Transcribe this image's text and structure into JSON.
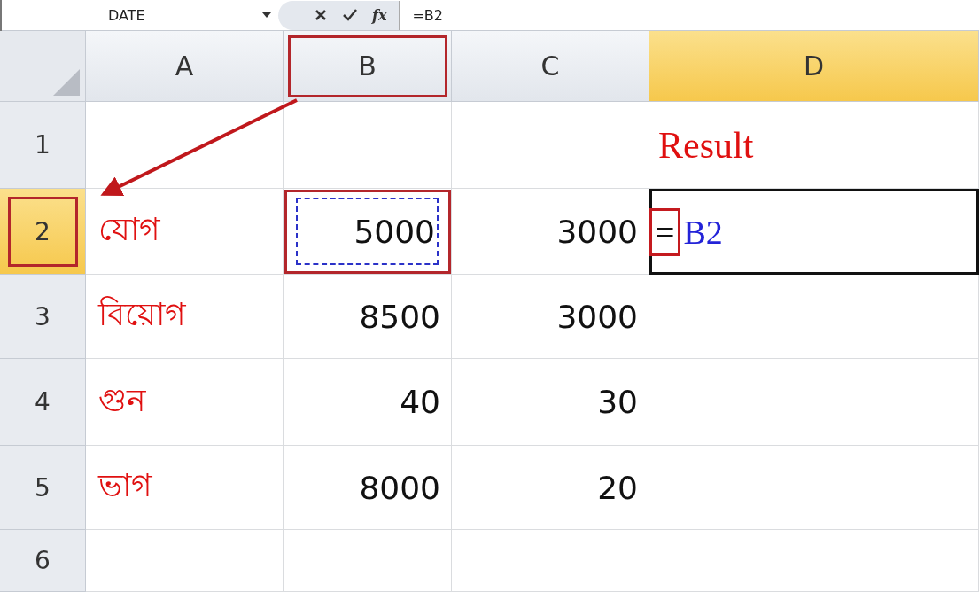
{
  "name_box": {
    "value": "DATE"
  },
  "formula_bar": {
    "function_label": "fx",
    "value": "=B2"
  },
  "columns": [
    {
      "label": "A",
      "selected": false,
      "annotated": false
    },
    {
      "label": "B",
      "selected": false,
      "annotated": true
    },
    {
      "label": "C",
      "selected": false,
      "annotated": false
    },
    {
      "label": "D",
      "selected": true,
      "annotated": false
    }
  ],
  "rows": [
    {
      "label": "1",
      "selected": false,
      "annotated": false,
      "cells": [
        {
          "kind": "empty"
        },
        {
          "kind": "empty"
        },
        {
          "kind": "empty"
        },
        {
          "kind": "heading",
          "value": "Result"
        }
      ]
    },
    {
      "label": "2",
      "selected": true,
      "annotated": true,
      "cells": [
        {
          "kind": "label",
          "value": "যোগ"
        },
        {
          "kind": "number",
          "value": "5000",
          "referenced": true,
          "annotated": true
        },
        {
          "kind": "number",
          "value": "3000"
        },
        {
          "kind": "edit",
          "prefix": "=",
          "reference": "B2",
          "prefix_annotated": true
        }
      ]
    },
    {
      "label": "3",
      "selected": false,
      "annotated": false,
      "cells": [
        {
          "kind": "label",
          "value": "বিয়োগ"
        },
        {
          "kind": "number",
          "value": "8500"
        },
        {
          "kind": "number",
          "value": "3000"
        },
        {
          "kind": "empty"
        }
      ]
    },
    {
      "label": "4",
      "selected": false,
      "annotated": false,
      "cells": [
        {
          "kind": "label",
          "value": "গুন"
        },
        {
          "kind": "number",
          "value": "40"
        },
        {
          "kind": "number",
          "value": "30"
        },
        {
          "kind": "empty"
        }
      ]
    },
    {
      "label": "5",
      "selected": false,
      "annotated": false,
      "cells": [
        {
          "kind": "label",
          "value": "ভাগ"
        },
        {
          "kind": "number",
          "value": "8000"
        },
        {
          "kind": "number",
          "value": "20"
        },
        {
          "kind": "empty"
        }
      ]
    },
    {
      "label": "6",
      "selected": false,
      "annotated": false,
      "cells": [
        {
          "kind": "empty"
        },
        {
          "kind": "empty"
        },
        {
          "kind": "empty"
        },
        {
          "kind": "empty"
        }
      ]
    }
  ]
}
